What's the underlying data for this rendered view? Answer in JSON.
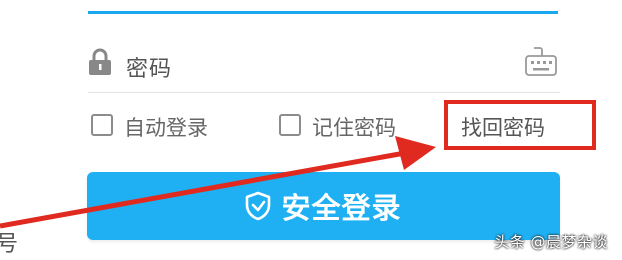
{
  "password": {
    "placeholder": "密码"
  },
  "options": {
    "auto_login_label": "自动登录",
    "remember_password_label": "记住密码",
    "recover_password_label": "找回密码"
  },
  "login_button": {
    "label": "安全登录"
  },
  "cut_text": "号",
  "watermark": "头条 @晨梦杂谈",
  "colors": {
    "accent": "#1eb0f2",
    "underline": "#1ba8f0",
    "highlight": "#e02a20"
  },
  "icons": {
    "lock": "lock-icon",
    "keyboard": "keyboard-icon",
    "shield": "shield-icon"
  }
}
